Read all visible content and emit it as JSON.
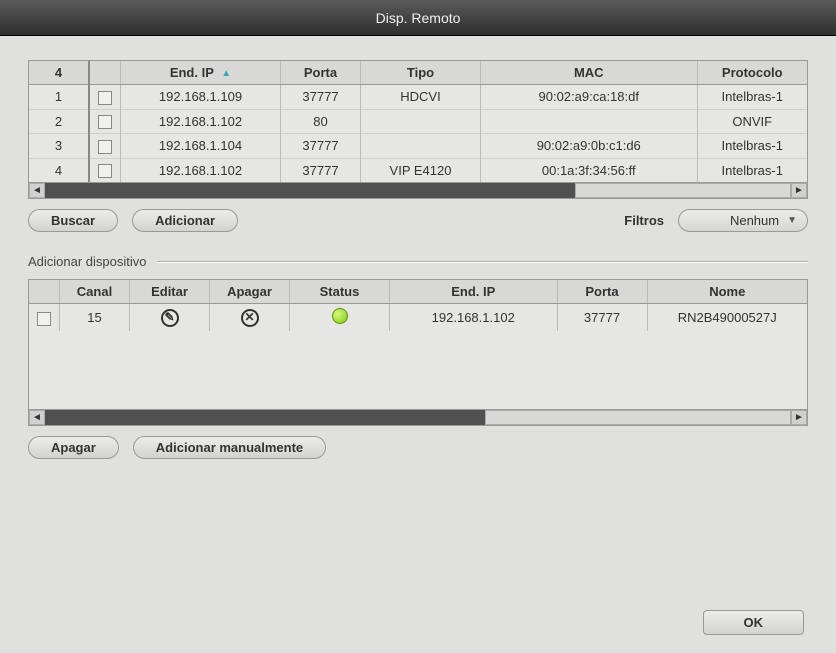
{
  "title": "Disp. Remoto",
  "top_table": {
    "count_header": "4",
    "headers": {
      "ip": "End. IP",
      "port": "Porta",
      "type": "Tipo",
      "mac": "MAC",
      "protocol": "Protocolo"
    },
    "rows": [
      {
        "idx": "1",
        "ip": "192.168.1.109",
        "port": "37777",
        "type": "HDCVI",
        "mac": "90:02:a9:ca:18:df",
        "protocol": "Intelbras-1"
      },
      {
        "idx": "2",
        "ip": "192.168.1.102",
        "port": "80",
        "type": "",
        "mac": "",
        "protocol": "ONVIF"
      },
      {
        "idx": "3",
        "ip": "192.168.1.104",
        "port": "37777",
        "type": "",
        "mac": "90:02:a9:0b:c1:d6",
        "protocol": "Intelbras-1"
      },
      {
        "idx": "4",
        "ip": "192.168.1.102",
        "port": "37777",
        "type": "VIP E4120",
        "mac": "00:1a:3f:34:56:ff",
        "protocol": "Intelbras-1"
      }
    ]
  },
  "buttons": {
    "search": "Buscar",
    "add": "Adicionar",
    "delete": "Apagar",
    "add_manual": "Adicionar manualmente",
    "ok": "OK"
  },
  "filters_label": "Filtros",
  "filter_dropdown": "Nenhum",
  "section_title": "Adicionar dispositivo",
  "bottom_table": {
    "headers": {
      "channel": "Canal",
      "edit": "Editar",
      "delete": "Apagar",
      "status": "Status",
      "ip": "End. IP",
      "port": "Porta",
      "name": "Nome"
    },
    "rows": [
      {
        "channel": "15",
        "ip": "192.168.1.102",
        "port": "37777",
        "name": "RN2B49000527J"
      }
    ]
  }
}
